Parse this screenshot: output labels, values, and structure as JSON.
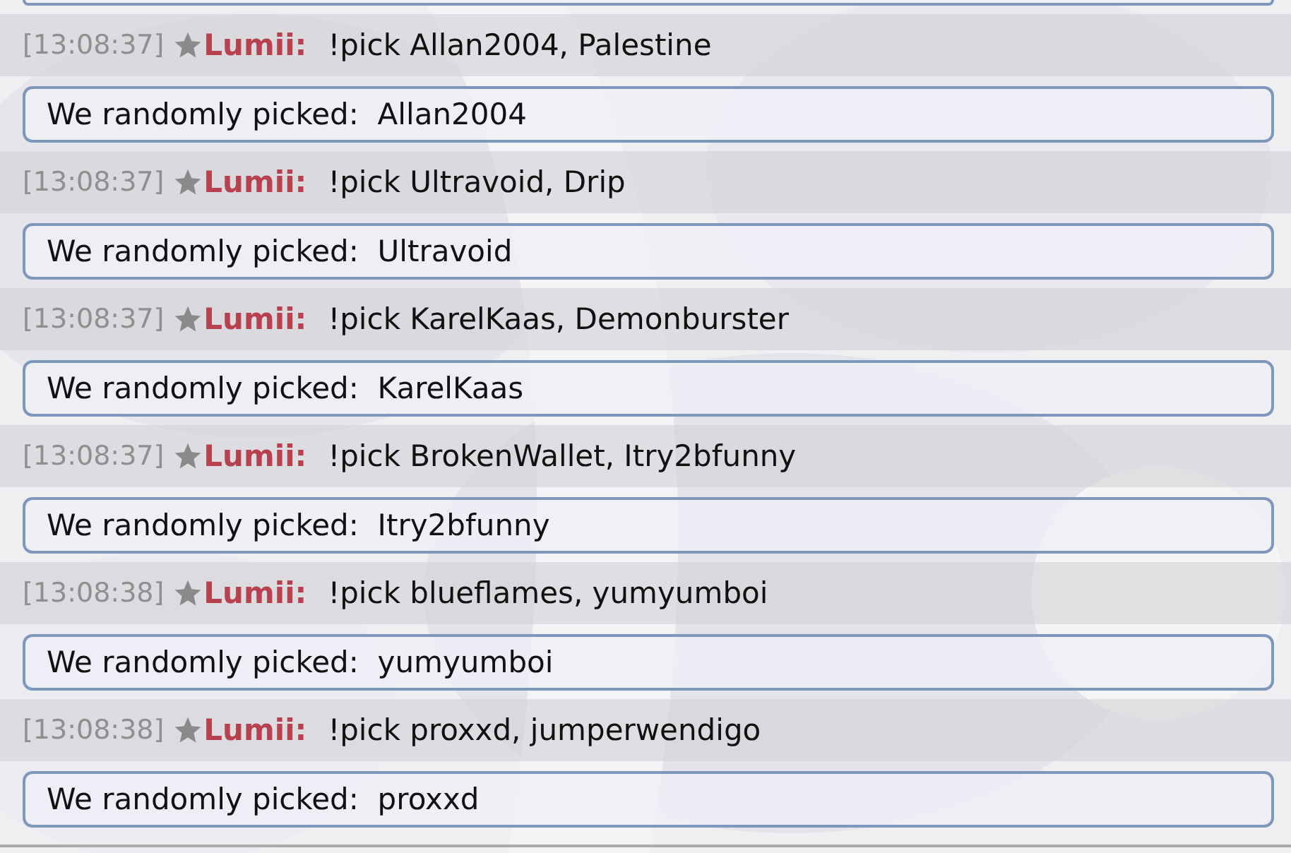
{
  "messages": [
    {
      "time": "[13:08:37]",
      "user": "Lumii:",
      "text": "!pick Allan2004, Palestine",
      "reply": "We randomly picked:  Allan2004"
    },
    {
      "time": "[13:08:37]",
      "user": "Lumii:",
      "text": "!pick Ultravoid, Drip",
      "reply": "We randomly picked:  Ultravoid"
    },
    {
      "time": "[13:08:37]",
      "user": "Lumii:",
      "text": "!pick KarelKaas, Demonburster",
      "reply": "We randomly picked:  KarelKaas"
    },
    {
      "time": "[13:08:37]",
      "user": "Lumii:",
      "text": "!pick BrokenWallet, Itry2bfunny",
      "reply": "We randomly picked:  Itry2bfunny"
    },
    {
      "time": "[13:08:38]",
      "user": "Lumii:",
      "text": "!pick blueflames, yumyumboi",
      "reply": "We randomly picked:  yumyumboi"
    },
    {
      "time": "[13:08:38]",
      "user": "Lumii:",
      "text": "!pick proxxd, jumperwendigo",
      "reply": "We randomly picked:  proxxd"
    }
  ]
}
